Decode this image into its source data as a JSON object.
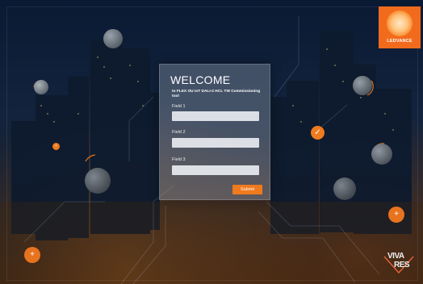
{
  "brand": {
    "name": "LEDVANCE",
    "accent": "#f26b1d"
  },
  "form": {
    "title": "WELCOME",
    "subtitle": "to FLEX OU IoT DALI-2 HCL TW Commissioning tool",
    "fields": [
      {
        "label": "Field 1",
        "value": ""
      },
      {
        "label": "Field 2",
        "value": ""
      },
      {
        "label": "Field 3",
        "value": ""
      }
    ],
    "submit_label": "Submit"
  },
  "footer_logo": {
    "line1": "VIVA",
    "line2": "RES"
  },
  "icons": {
    "check": "check-icon",
    "chevron": "chevron-right-icon",
    "plus": "plus-icon"
  }
}
